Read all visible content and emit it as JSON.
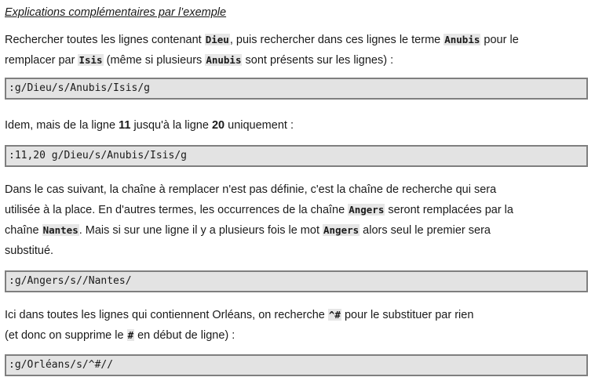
{
  "title": "Explications complémentaires par l’exemple",
  "blocks": [
    {
      "intro": {
        "t1": "Rechercher toutes les lignes contenant ",
        "c1": "Dieu",
        "t2": ", puis rechercher dans ces lignes le terme ",
        "c2": "Anubis",
        "t3": " pour le",
        "t4": "remplacer par ",
        "c3": "Isis",
        "t5": " (même si plusieurs ",
        "c4": "Anubis",
        "t6": " sont présents sur les lignes) :"
      },
      "command": ":g/Dieu/s/Anubis/Isis/g"
    },
    {
      "intro": {
        "t1": "Idem, mais de la ligne ",
        "b1": "11",
        "t2": " jusqu'à la ligne ",
        "b2": "20",
        "t3": " uniquement :"
      },
      "command": ":11,20 g/Dieu/s/Anubis/Isis/g"
    },
    {
      "intro": {
        "t1": "Dans le cas suivant, la chaîne à remplacer n'est pas définie, c'est la chaîne de recherche qui sera",
        "t2": "utilisée à la place. En d'autres termes, les occurrences de la chaîne ",
        "c1": "Angers",
        "t3": " seront remplacées par la",
        "t4": "chaîne ",
        "c2": "Nantes",
        "t5": ". Mais si sur une ligne il y a plusieurs fois le mot ",
        "c3": "Angers",
        "t6": " alors seul le premier sera",
        "t7": "substitué."
      },
      "command": ":g/Angers/s//Nantes/"
    },
    {
      "intro": {
        "t1": "Ici dans toutes les lignes qui contiennent Orléans,  on recherche ",
        "c1": "^#",
        "t2": " pour le substituer par rien",
        "t3": "(et donc on supprime le ",
        "c2": "#",
        "t4": " en début de ligne) :"
      },
      "command": ":g/Orléans/s/^#//"
    }
  ]
}
